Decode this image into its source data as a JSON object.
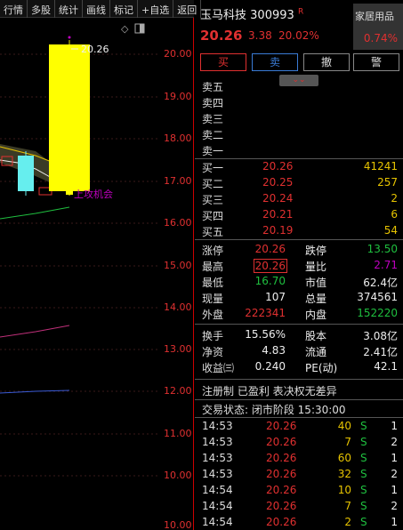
{
  "menu": [
    "行情",
    "多股",
    "统计",
    "画线",
    "标记",
    "+自选",
    "返回"
  ],
  "chart": {
    "ticks": [
      "20.00",
      "19.00",
      "18.00",
      "17.00",
      "16.00",
      "15.00",
      "14.00",
      "13.00",
      "12.00",
      "11.00",
      "10.00",
      "10.00"
    ],
    "high_label": "20.26",
    "annotation": "上攻机会"
  },
  "header": {
    "name": "玉马科技",
    "code": "300993",
    "suffix": "R",
    "sector": "家居用品",
    "sector_pct": "0.74%"
  },
  "quote": {
    "price": "20.26",
    "change": "3.38",
    "change_pct": "20.02%"
  },
  "buttons": {
    "buy": "买",
    "sell": "卖",
    "cancel": "撤",
    "alert": "警"
  },
  "collapse_icon": "chevron-double-down",
  "asks": [
    {
      "label": "卖五"
    },
    {
      "label": "卖四"
    },
    {
      "label": "卖三"
    },
    {
      "label": "卖二"
    },
    {
      "label": "卖一"
    }
  ],
  "bids": [
    {
      "label": "买一",
      "price": "20.26",
      "vol": "41241"
    },
    {
      "label": "买二",
      "price": "20.25",
      "vol": "257"
    },
    {
      "label": "买三",
      "price": "20.24",
      "vol": "2"
    },
    {
      "label": "买四",
      "price": "20.21",
      "vol": "6"
    },
    {
      "label": "买五",
      "price": "20.19",
      "vol": "54"
    }
  ],
  "stats": {
    "zt_l": "涨停",
    "zt_v": "20.26",
    "dt_l": "跌停",
    "dt_v": "13.50",
    "zg_l": "最高",
    "zg_v": "20.26",
    "lb_l": "量比",
    "lb_v": "2.71",
    "zd_l": "最低",
    "zd_v": "16.70",
    "sz_l": "市值",
    "sz_v": "62.4亿",
    "xl_l": "现量",
    "xl_v": "107",
    "zl_l": "总量",
    "zl_v": "374561",
    "wp_l": "外盘",
    "wp_v": "222341",
    "np_l": "内盘",
    "np_v": "152220",
    "hs_l": "换手",
    "hs_v": "15.56%",
    "gb_l": "股本",
    "gb_v": "3.08亿",
    "jz_l": "净资",
    "jz_v": "4.83",
    "lt_l": "流通",
    "lt_v": "2.41亿",
    "sy_l": "收益㈢",
    "sy_v": "0.240",
    "pe_l": "PE(动)",
    "pe_v": "42.1"
  },
  "notice": "注册制 已盈利 表决权无差异",
  "status": "交易状态: 闭市阶段 15:30:00",
  "trades": [
    {
      "time": "14:53",
      "price": "20.26",
      "vol": "40",
      "side": "S",
      "n": "1"
    },
    {
      "time": "14:53",
      "price": "20.26",
      "vol": "7",
      "side": "S",
      "n": "2"
    },
    {
      "time": "14:53",
      "price": "20.26",
      "vol": "60",
      "side": "S",
      "n": "1"
    },
    {
      "time": "14:53",
      "price": "20.26",
      "vol": "32",
      "side": "S",
      "n": "2"
    },
    {
      "time": "14:54",
      "price": "20.26",
      "vol": "10",
      "side": "S",
      "n": "1"
    },
    {
      "time": "14:54",
      "price": "20.26",
      "vol": "7",
      "side": "S",
      "n": "2"
    },
    {
      "time": "14:54",
      "price": "20.26",
      "vol": "2",
      "side": "S",
      "n": "1"
    }
  ]
}
